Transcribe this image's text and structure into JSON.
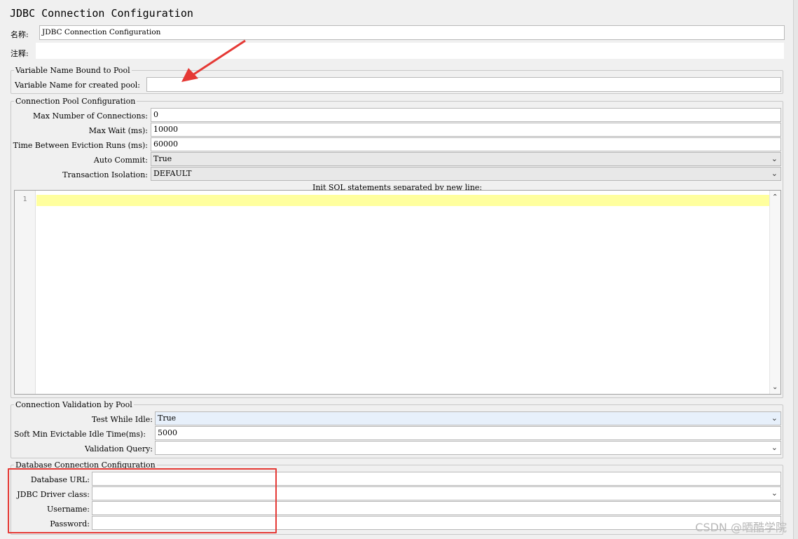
{
  "window_title": "JDBC Connection Configuration",
  "name_label": "名称:",
  "name_value": "JDBC Connection Configuration",
  "comments_label": "注释:",
  "comments_value": "",
  "variable_group": {
    "legend": "Variable Name Bound to Pool",
    "label": "Variable Name for created pool:",
    "value": ""
  },
  "pool_group": {
    "legend": "Connection Pool Configuration",
    "max_connections_label": "Max Number of Connections:",
    "max_connections_value": "0",
    "max_wait_label": "Max Wait (ms):",
    "max_wait_value": "10000",
    "eviction_label": "Time Between Eviction Runs (ms):",
    "eviction_value": "60000",
    "auto_commit_label": "Auto Commit:",
    "auto_commit_value": "True",
    "isolation_label": "Transaction Isolation:",
    "isolation_value": "DEFAULT",
    "init_sql_label": "Init SQL statements separated by new line:",
    "init_sql_line_number": "1"
  },
  "validation_group": {
    "legend": "Connection Validation by Pool",
    "test_idle_label": "Test While Idle:",
    "test_idle_value": "True",
    "soft_min_label": "Soft Min Evictable Idle Time(ms):",
    "soft_min_value": "5000",
    "validation_query_label": "Validation Query:",
    "validation_query_value": ""
  },
  "database_group": {
    "legend": "Database Connection Configuration",
    "url_label": "Database URL:",
    "url_value": "",
    "driver_label": "JDBC Driver class:",
    "driver_value": "",
    "username_label": "Username:",
    "username_value": "",
    "password_label": "Password:",
    "password_value": ""
  },
  "watermark": "CSDN @晒酷学院",
  "icons": {
    "dropdown": "chevron-down-icon",
    "scroll_up": "chevron-up-icon",
    "scroll_down": "chevron-down-icon"
  },
  "colors": {
    "current_line": "#ffff9e",
    "annotation_red": "#e53935",
    "combo_selected": "#e7f0fb"
  }
}
